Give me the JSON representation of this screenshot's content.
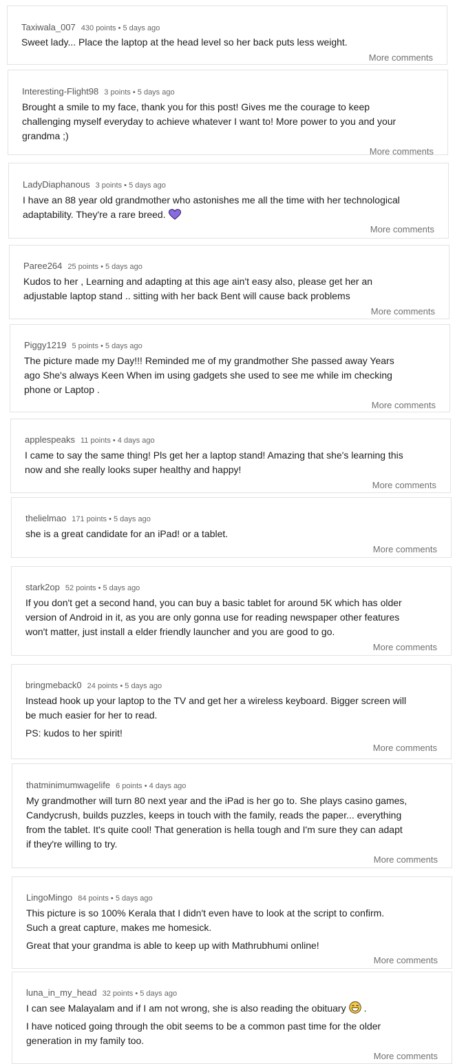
{
  "more_label": "More comments",
  "comments": [
    {
      "user": "Taxiwala_007",
      "meta": "430 points • 5 days ago",
      "lines": [
        "Sweet lady... Place the laptop at the head level so her back puts less weight."
      ]
    },
    {
      "user": "Interesting-Flight98",
      "meta": "3 points • 5 days ago",
      "lines": [
        "Brought a smile to my face, thank you for this post! Gives me the courage to keep",
        "challenging myself everyday to achieve whatever I want to! More power to you and your",
        "grandma ;)"
      ]
    },
    {
      "user": "LadyDiaphanous",
      "meta": "3 points • 5 days ago",
      "lines": [
        "I have an 88 year old grandmother who astonishes me all the time with her technological",
        "adaptability. They're a rare breed."
      ],
      "emoji": "purple-heart"
    },
    {
      "user": "Paree264",
      "meta": "25 points • 5 days ago",
      "lines": [
        "Kudos to her , Learning and adapting at this age ain't easy also, please get her an",
        "adjustable laptop stand .. sitting with her back Bent will cause back problems"
      ]
    },
    {
      "user": "Piggy1219",
      "meta": "5 points • 5 days ago",
      "lines": [
        "The picture made my Day!!! Reminded me of my grandmother She passed away Years",
        "ago She's always Keen When im using gadgets she used to see me while im checking",
        "phone or Laptop ."
      ]
    },
    {
      "user": "applespeaks",
      "meta": "11 points • 4 days ago",
      "lines": [
        "I came to say the same thing! Pls get her a laptop stand! Amazing that she's learning this",
        "now and she really looks super healthy and happy!"
      ]
    },
    {
      "user": "thelielmao",
      "meta": "171 points • 5 days ago",
      "lines": [
        "she is a great candidate for an iPad! or a tablet."
      ]
    },
    {
      "user": "stark2op",
      "meta": "52 points • 5 days ago",
      "lines": [
        "If you don't get a second hand, you can buy a basic tablet for around 5K which has older",
        "version of Android in it, as you are only gonna use for reading newspaper other features",
        "won't matter, just install a elder friendly launcher and you are good to go."
      ]
    },
    {
      "user": "bringmeback0",
      "meta": "24 points • 5 days ago",
      "lines": [
        "Instead hook up your laptop to the TV and get her a wireless keyboard. Bigger screen will",
        "be much easier for her to read."
      ],
      "extra": [
        "PS: kudos to her spirit!"
      ]
    },
    {
      "user": "thatminimumwagelife",
      "meta": "6 points • 4 days ago",
      "lines": [
        "My grandmother will turn 80 next year and the iPad is her go to. She plays casino games,",
        "Candycrush, builds puzzles, keeps in touch with the family, reads the paper... everything",
        "from the tablet. It's quite cool! That generation is hella tough and I'm sure they can adapt",
        "if they're willing to try."
      ]
    },
    {
      "user": "LingoMingo",
      "meta": "84 points • 5 days ago",
      "lines": [
        "This picture is so 100% Kerala that I didn't even have to look at the script to confirm.",
        "Such a great capture, makes me homesick."
      ],
      "extra": [
        "Great that your grandma is able to keep up with Mathrubhumi online!"
      ]
    },
    {
      "user": "luna_in_my_head",
      "meta": "32 points • 5 days ago",
      "lines": [
        "I can see Malayalam and if I am not wrong, she is also reading the obituary"
      ],
      "emoji": "grin-sweat",
      "emoji_suffix": ".",
      "extra": [
        "I have noticed going through the obit seems to be a common past time for the older",
        "generation in my family too."
      ]
    }
  ]
}
